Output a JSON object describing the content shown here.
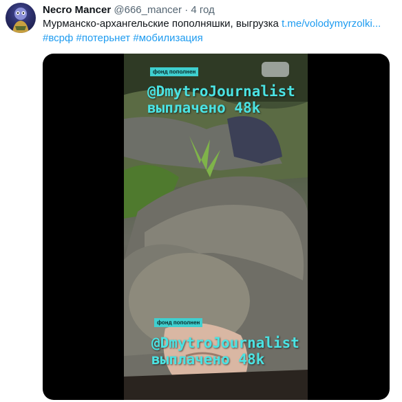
{
  "tweet": {
    "author_name": "Necro Mancer",
    "handle": "@666_mancer",
    "separator": "·",
    "time": "4 год",
    "text_main": "Мурманско-архангельские пополняшки, выгрузка ",
    "text_link": "t.me/volodymyrzolki...",
    "hashtags": [
      "#всрф",
      "#потерьнет",
      "#мобилизация"
    ]
  },
  "video": {
    "watermark_top": {
      "badge": "фонд пополнен",
      "handle": "@DmytroJournalist",
      "paid": "выплачено 48k"
    },
    "watermark_bottom": {
      "badge": "фонд пополнен",
      "handle": "@DmytroJournalist",
      "paid": "выплачено 48k"
    }
  },
  "colors": {
    "link": "#1d9bf0",
    "secondary_text": "#536471",
    "primary_text": "#0f1419",
    "watermark": "#4be3e3"
  }
}
